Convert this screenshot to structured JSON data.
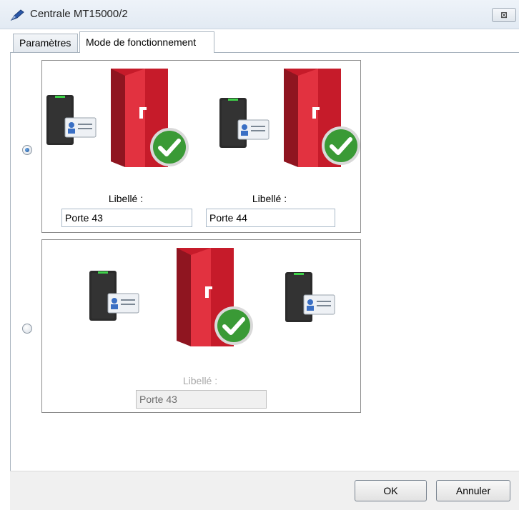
{
  "window": {
    "title": "Centrale MT15000/2",
    "close_label": "⊠"
  },
  "tabs": [
    {
      "label": "Paramètres",
      "active": false
    },
    {
      "label": "Mode de fonctionnement",
      "active": true
    }
  ],
  "modes": [
    {
      "selected": true,
      "doors": [
        {
          "label": "Libellé :",
          "value": "Porte 43"
        },
        {
          "label": "Libellé :",
          "value": "Porte 44"
        }
      ]
    },
    {
      "selected": false,
      "doors": [
        {
          "label": "Libellé :",
          "value": "Porte 43"
        }
      ]
    }
  ],
  "buttons": {
    "ok": "OK",
    "cancel": "Annuler"
  },
  "icons": [
    "pen-icon",
    "card-reader-icon",
    "badge-icon",
    "door-icon",
    "check-icon"
  ],
  "colors": {
    "door_red": "#c61b2a",
    "check_green": "#3a9a36",
    "reader_dark": "#2b2b2b"
  }
}
